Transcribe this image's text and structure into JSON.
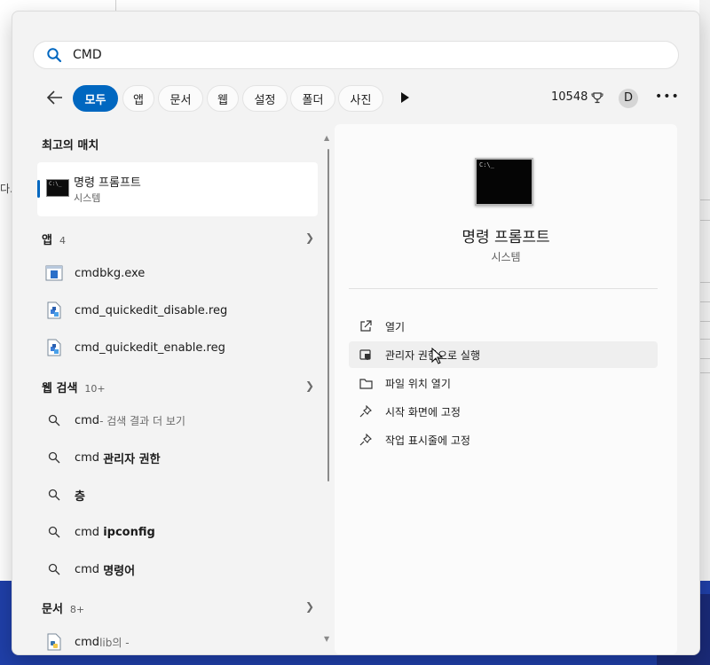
{
  "search": {
    "query": "CMD"
  },
  "filters": {
    "chips": [
      "모두",
      "앱",
      "문서",
      "웹",
      "설정",
      "폴더",
      "사진"
    ],
    "points": "10548",
    "avatar": "D"
  },
  "best_match": {
    "heading": "최고의 매치",
    "title": "명령 프롬프트",
    "subtitle": "시스템"
  },
  "apps": {
    "heading": "앱",
    "count": "4",
    "items": [
      "cmdbkg.exe",
      "cmd_quickedit_disable.reg",
      "cmd_quickedit_enable.reg"
    ]
  },
  "web": {
    "heading": "웹 검색",
    "count": "10+",
    "items": [
      {
        "prefix": "cmd",
        "suffix": " - 검색 결과 더 보기"
      },
      {
        "prefix": "cmd ",
        "bold": "관리자 권한"
      },
      {
        "bold": "층"
      },
      {
        "prefix": "cmd ",
        "bold": "ipconfig"
      },
      {
        "prefix": "cmd ",
        "bold": "명령어"
      }
    ]
  },
  "docs": {
    "heading": "문서",
    "count": "8+",
    "item_main": "cmd",
    "item_sub": "lib의 -"
  },
  "details": {
    "title": "명령 프롬프트",
    "subtitle": "시스템",
    "actions": [
      "열기",
      "관리자 권한으로 실행",
      "파일 위치 열기",
      "시작 화면에 고정",
      "작업 표시줄에 고정"
    ]
  },
  "background": {
    "left_fragment": "다."
  },
  "colors": {
    "accent": "#0067c0",
    "panel": "#f3f3f3",
    "desktop": "#1f3fa8"
  }
}
